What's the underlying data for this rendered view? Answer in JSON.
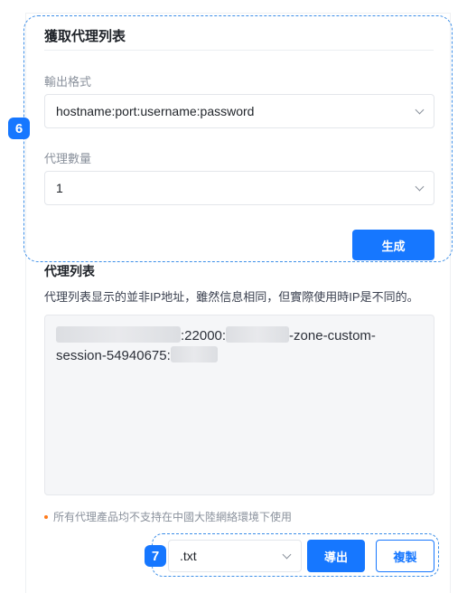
{
  "get_proxy_list": {
    "title": "獲取代理列表",
    "output_format": {
      "label": "輸出格式",
      "value": "hostname:port:username:password"
    },
    "proxy_count": {
      "label": "代理數量",
      "value": "1"
    },
    "generate_button": "生成"
  },
  "proxy_list": {
    "title": "代理列表",
    "description": "代理列表显示的並非IP地址，雖然信息相同，但實際使用時IP是不同的。",
    "port_segment": ":22000:",
    "user_segment": "-zone-custom-",
    "session_segment": "session-54940675:"
  },
  "notice": "所有代理產品均不支持在中國大陸網絡環境下使用",
  "export": {
    "format_value": ".txt",
    "export_button": "導出",
    "copy_button": "複製"
  },
  "badges": {
    "step6": "6",
    "step7": "7"
  },
  "colors": {
    "accent": "#1677ff",
    "highlight": "#3d8fe8",
    "notice_dot": "#ff7a1a"
  }
}
